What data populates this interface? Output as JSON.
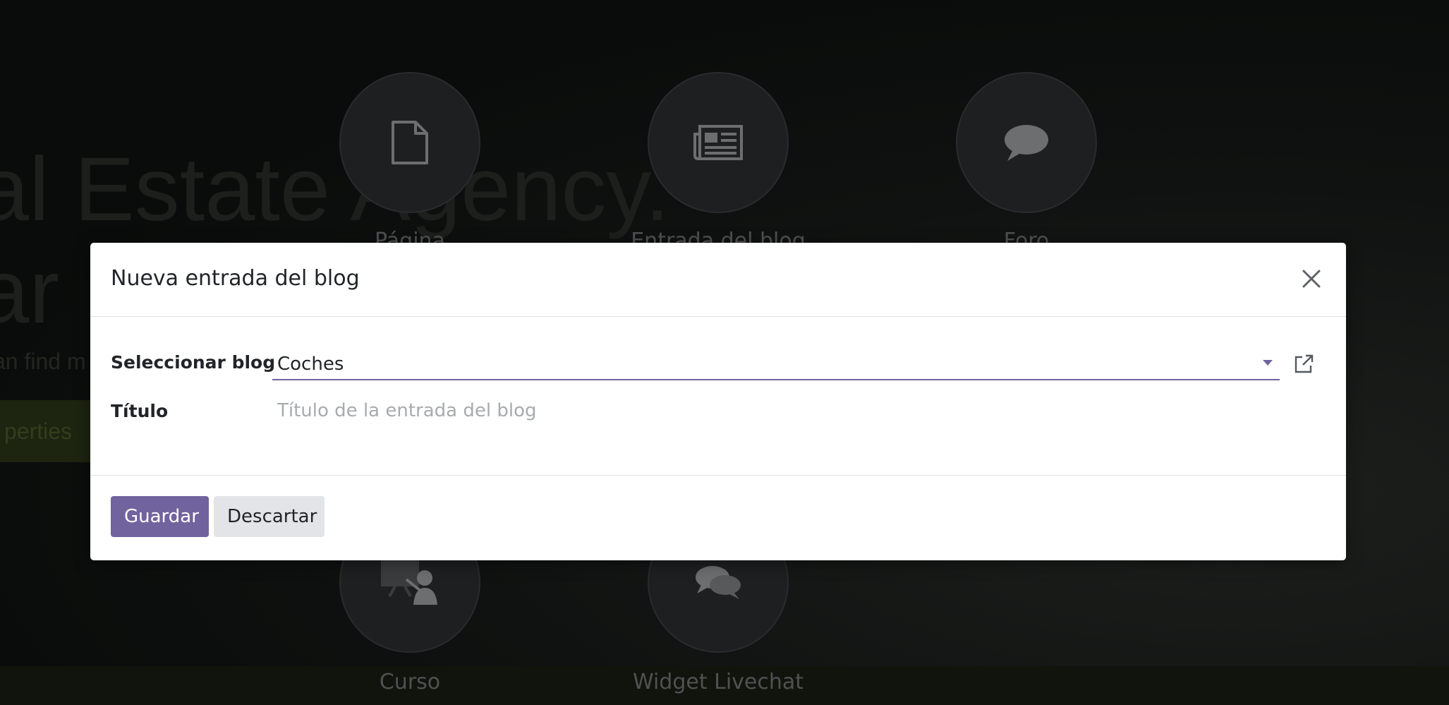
{
  "background": {
    "hero_line_1": "al Estate Agency.",
    "hero_line_2": "ar",
    "hero_subtitle": "an find m",
    "hero_button": "perties",
    "content_types": [
      {
        "label": "Página",
        "icon": "file-icon"
      },
      {
        "label": "Entrada del blog",
        "icon": "newspaper-icon"
      },
      {
        "label": "Foro",
        "icon": "comment-icon"
      },
      {
        "label": "Curso",
        "icon": "presentation-icon"
      },
      {
        "label": "Widget Livechat",
        "icon": "comments-icon"
      }
    ]
  },
  "modal": {
    "title": "Nueva entrada del blog",
    "fields": {
      "blog_label": "Seleccionar blog",
      "blog_value": "Coches",
      "title_label": "Título",
      "title_placeholder": "Título de la entrada del blog",
      "title_value": ""
    },
    "buttons": {
      "save": "Guardar",
      "discard": "Descartar"
    }
  },
  "colors": {
    "primary": "#71639e",
    "discard_bg": "#e2e4e8",
    "backdrop": "#0a0c0b"
  }
}
